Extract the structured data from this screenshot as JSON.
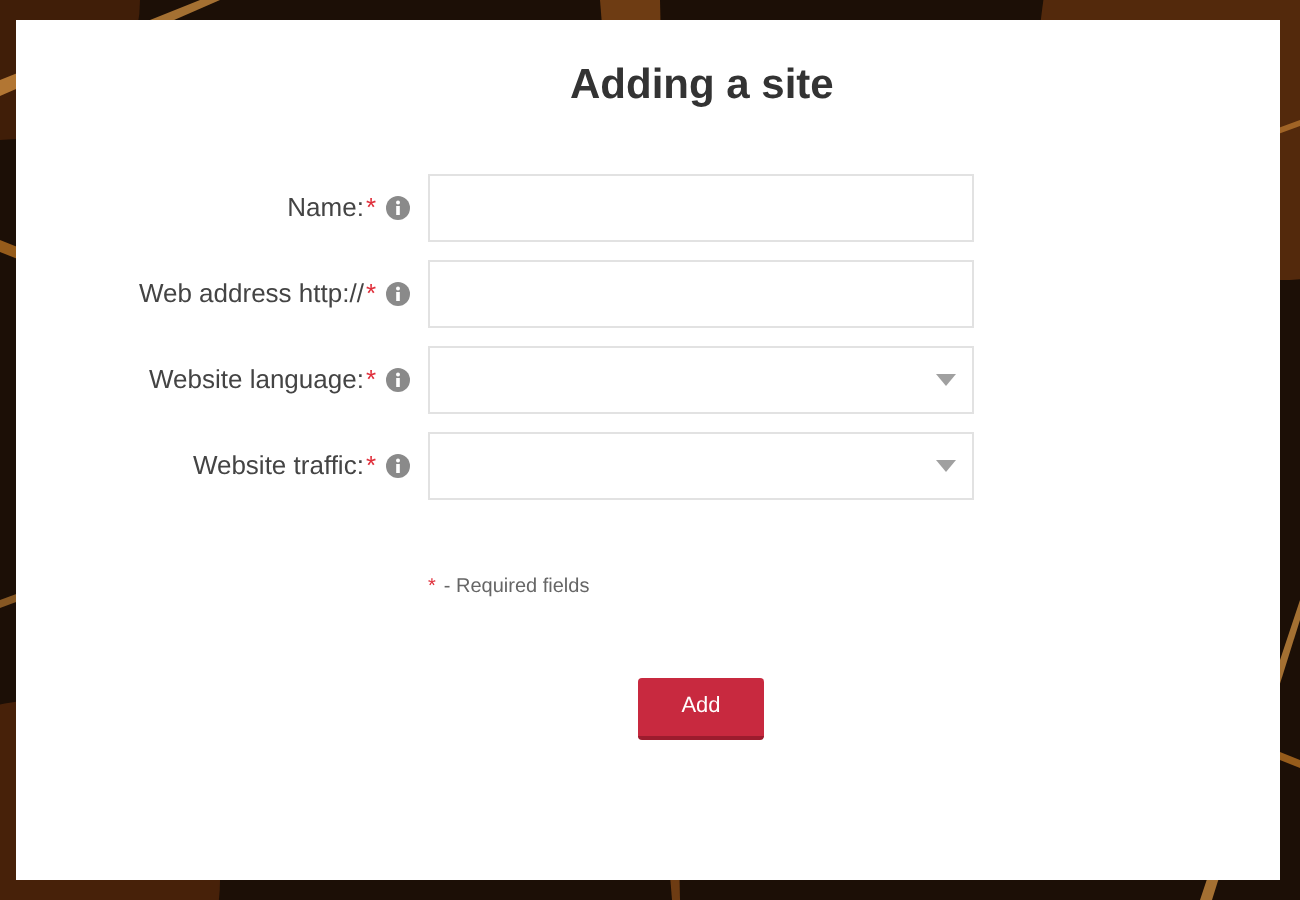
{
  "title": "Adding a site",
  "fields": [
    {
      "label": "Name:",
      "required_mark": "*",
      "kind": "text"
    },
    {
      "label": "Web address http://",
      "required_mark": "*",
      "kind": "text"
    },
    {
      "label": "Website language:",
      "required_mark": "*",
      "kind": "select"
    },
    {
      "label": "Website traffic:",
      "required_mark": "*",
      "kind": "select"
    }
  ],
  "required_note": {
    "mark": "*",
    "text": "- Required fields"
  },
  "submit_button": "Add"
}
